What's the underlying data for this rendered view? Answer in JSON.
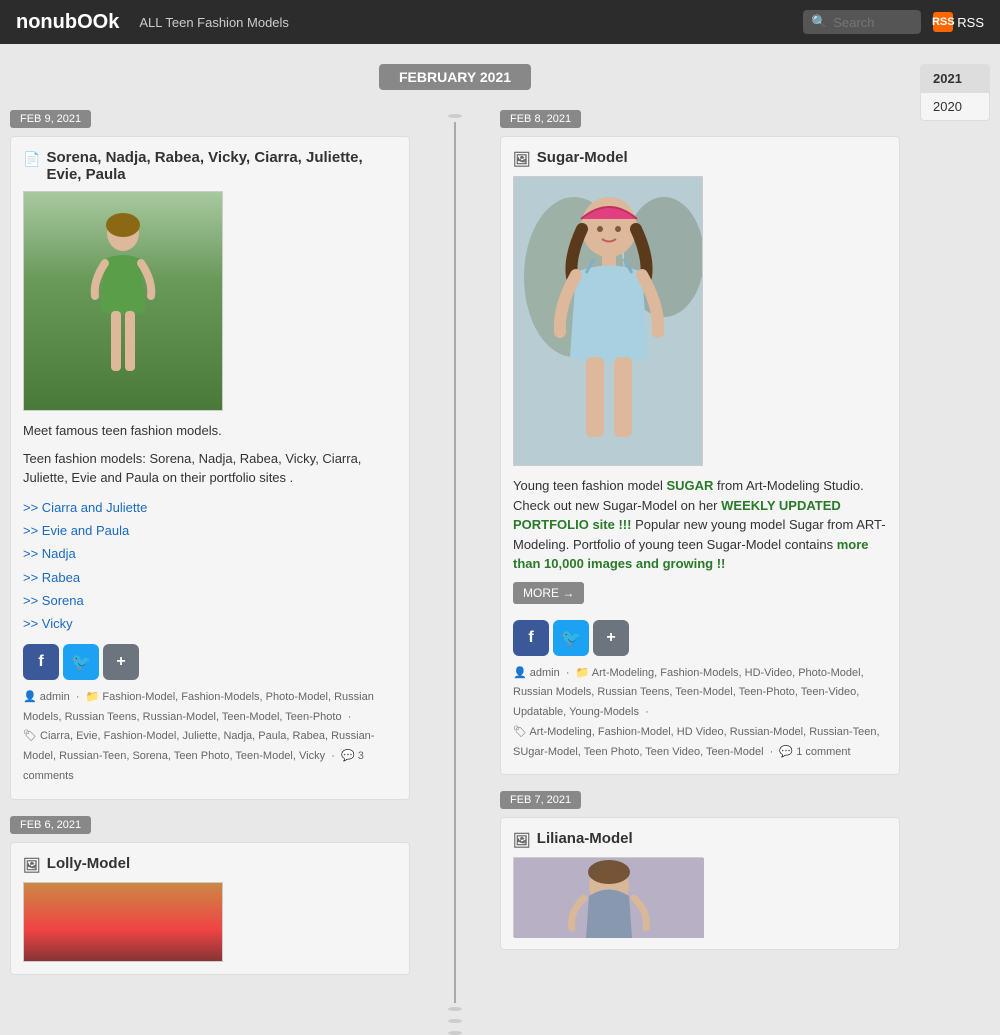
{
  "header": {
    "site_title": "nonubOOk",
    "site_subtitle": "ALL Teen Fashion Models",
    "search_placeholder": "Search",
    "rss_label": "RSS"
  },
  "sidebar": {
    "years": [
      {
        "label": "2021",
        "active": true
      },
      {
        "label": "2020",
        "active": false
      }
    ]
  },
  "month_header": "FEBRUARY 2021",
  "posts": [
    {
      "id": "post1",
      "date": "FEB 9, 2021",
      "side": "left",
      "icon": "📄",
      "title": "Sorena, Nadja, Rabea, Vicky, Ciarra, Juliette, Evie, Paula",
      "image_desc": "girl in green top outdoors",
      "intro": "Meet famous teen fashion models.",
      "body": "Teen fashion models: Sorena, Nadja, Rabea, Vicky, Ciarra, Juliette, Evie and Paula on their portfolio sites .",
      "links": [
        ">> Ciarra and Juliette",
        ">> Evie and Paula",
        ">> Nadja",
        ">> Rabea",
        ">> Sorena",
        ">> Vicky"
      ],
      "meta_author": "admin",
      "meta_categories": "Fashion-Model, Fashion-Models, Photo-Model, Russian Models, Russian Teens, Russian-Model, Teen-Model, Teen-Photo",
      "meta_tags": "Ciarra, Evie, Fashion-Model, Juliette, Nadja, Paula, Rabea, Russian-Model, Russian-Teen, Sorena, Teen Photo, Teen-Model, Vicky",
      "meta_comments": "3 comments"
    },
    {
      "id": "post2",
      "date": "FEB 8, 2021",
      "side": "right",
      "icon": "🖼",
      "title": "Sugar-Model",
      "image_desc": "teen girl in light blue dress",
      "text_before": "Young teen fashion model ",
      "sugar_link": "SUGAR",
      "text_mid": " from Art-Modeling Studio. Check out new Sugar-Model on her ",
      "weekly_link": "WEEKLY UPDATED PORTFOLIO site !!!",
      "text_after": " Popular new young model Sugar from ART-Modeling. Portfolio of young teen Sugar-Model contains ",
      "more_link": "more than 10,000 images and growing !!",
      "more_btn": "MORE →",
      "meta_author": "admin",
      "meta_categories": "Art-Modeling, Fashion-Models, HD-Video, Photo-Model, Russian Models, Russian Teens, Teen-Model, Teen-Photo, Teen-Video, Updatable, Young-Models",
      "meta_tags": "Art-Modeling, Fashion-Model, HD Video, Russian-Model, Russian-Teen, SUgar-Model, Teen Photo, Teen Video, Teen-Model",
      "meta_comments": "1 comment"
    },
    {
      "id": "post3",
      "date": "FEB 7, 2021",
      "side": "right",
      "icon": "🖼",
      "title": "Liliana-Model",
      "image_desc": "teen girl portrait"
    },
    {
      "id": "post4",
      "date": "FEB 6, 2021",
      "side": "left",
      "icon": "🖼",
      "title": "Lolly-Model",
      "image_desc": "teen girl in red"
    }
  ]
}
